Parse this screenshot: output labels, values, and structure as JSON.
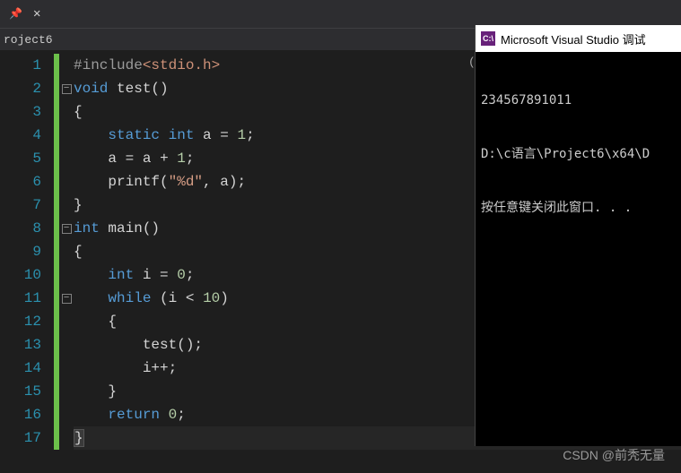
{
  "tab": {
    "pin_glyph": "📌",
    "close_glyph": "✕"
  },
  "file_bar": {
    "name": "roject6",
    "fullscreen_label": "(全局"
  },
  "console": {
    "title": "Microsoft Visual Studio 调试",
    "icon_text": "C:\\",
    "lines": [
      "234567891011",
      "D:\\c语言\\Project6\\x64\\D",
      "按任意键关闭此窗口. . ."
    ]
  },
  "watermark": "CSDN @前秃无量",
  "code": {
    "l1": {
      "pp": "#include",
      "inc": "<stdio.h>"
    },
    "l2": {
      "kw": "void",
      "fn": "test",
      "paren": "()"
    },
    "l3": {
      "brace": "{"
    },
    "l4": {
      "kw1": "static",
      "kw2": "int",
      "id": "a",
      "op": "=",
      "num": "1",
      "semi": ";"
    },
    "l5": {
      "id1": "a",
      "op1": "=",
      "id2": "a",
      "op2": "+",
      "num": "1",
      "semi": ";"
    },
    "l6": {
      "fn": "printf",
      "lp": "(",
      "str": "\"%d\"",
      "comma": ",",
      "id": "a",
      "rp": ")",
      "semi": ";"
    },
    "l7": {
      "brace": "}"
    },
    "l8": {
      "kw": "int",
      "fn": "main",
      "paren": "()"
    },
    "l9": {
      "brace": "{"
    },
    "l10": {
      "kw": "int",
      "id": "i",
      "op": "=",
      "num": "0",
      "semi": ";"
    },
    "l11": {
      "kw": "while",
      "lp": "(",
      "id": "i",
      "op": "<",
      "num": "10",
      "rp": ")"
    },
    "l12": {
      "brace": "{"
    },
    "l13": {
      "fn": "test",
      "paren": "()",
      "semi": ";"
    },
    "l14": {
      "id": "i",
      "op": "++",
      "semi": ";"
    },
    "l15": {
      "brace": "}"
    },
    "l16": {
      "kw": "return",
      "num": "0",
      "semi": ";"
    },
    "l17": {
      "brace": "}"
    }
  },
  "line_numbers": [
    "1",
    "2",
    "3",
    "4",
    "5",
    "6",
    "7",
    "8",
    "9",
    "10",
    "11",
    "12",
    "13",
    "14",
    "15",
    "16",
    "17"
  ]
}
